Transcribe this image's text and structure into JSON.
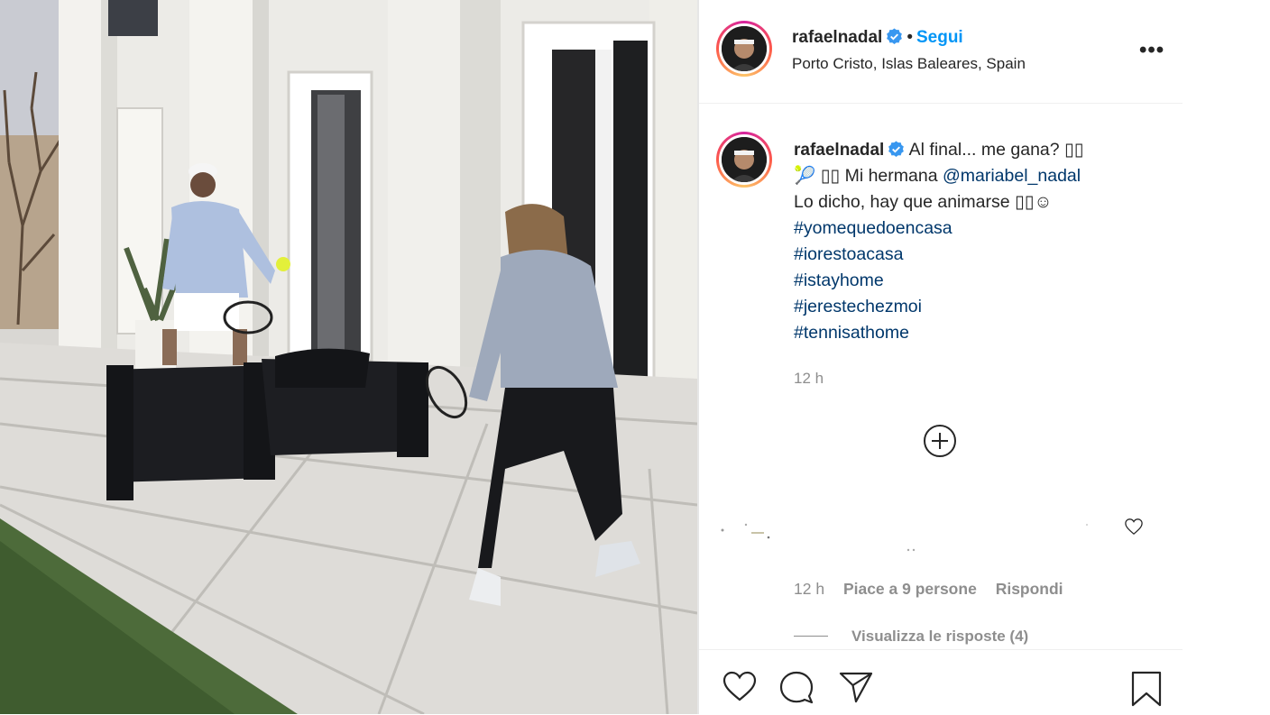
{
  "post": {
    "username": "rafaelnadal",
    "follow_label": "Segui",
    "separator": "•",
    "location": "Porto Cristo, Islas Baleares, Spain",
    "more_label": "•••"
  },
  "caption": {
    "username": "rafaelnadal",
    "line1": "Al final... me gana? ▯▯",
    "line2_text": "🎾 ▯▯ Mi hermana ",
    "mention": "@mariabel_nadal",
    "line3": "Lo dicho, hay que animarse ▯▯☺",
    "hashtags": [
      "#yomequedoencasa",
      "#iorestoacasa",
      "#istayhome",
      "#jerestechezmoi",
      "#tennisathome"
    ],
    "time": "12 h"
  },
  "comment": {
    "time": "12 h",
    "likes": "Piace a 9 persone",
    "reply": "Rispondi",
    "view_replies": "Visualizza le risposte (4)"
  },
  "icons": {
    "like": "heart-icon",
    "comment": "comment-icon",
    "share": "share-icon",
    "save": "bookmark-icon",
    "load_more": "plus-circle-icon",
    "verified": "verified-badge-icon"
  },
  "colors": {
    "follow": "#0095f6",
    "hashtag": "#00376b",
    "verified": "#3897f0",
    "muted": "#8e8e8e"
  }
}
